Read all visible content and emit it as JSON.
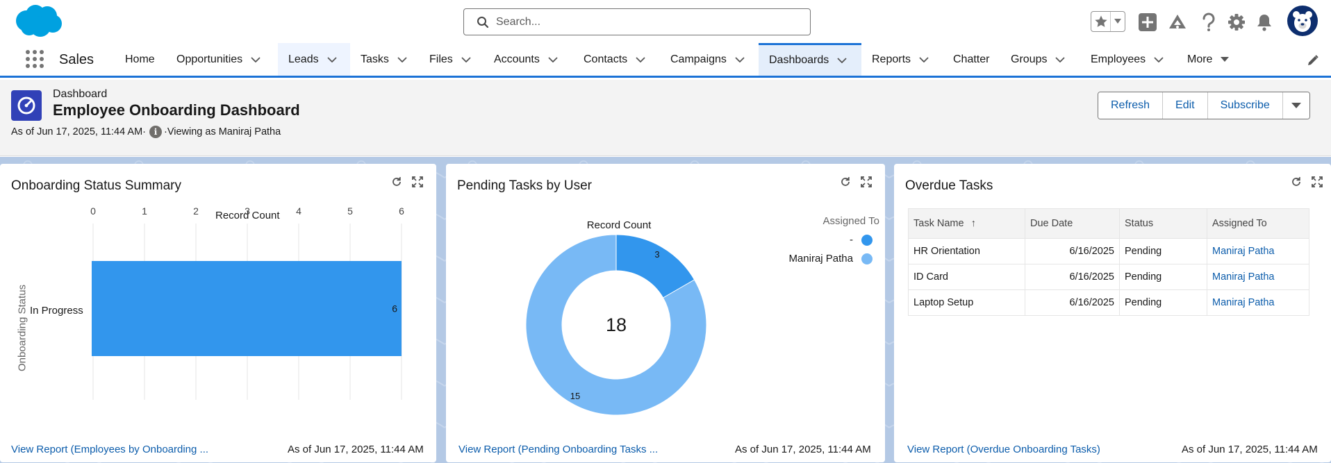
{
  "header": {
    "search_placeholder": "Search...",
    "avatar_icon": "bear-avatar-icon",
    "brand_color": "#00a1e0"
  },
  "nav": {
    "app_name": "Sales",
    "items": [
      {
        "label": "Home",
        "chevron": false
      },
      {
        "label": "Opportunities",
        "chevron": true
      },
      {
        "label": "Leads",
        "chevron": true
      },
      {
        "label": "Tasks",
        "chevron": true
      },
      {
        "label": "Files",
        "chevron": true
      },
      {
        "label": "Accounts",
        "chevron": true
      },
      {
        "label": "Contacts",
        "chevron": true
      },
      {
        "label": "Campaigns",
        "chevron": true
      },
      {
        "label": "Dashboards",
        "chevron": true,
        "active": true
      },
      {
        "label": "Reports",
        "chevron": true
      },
      {
        "label": "Chatter",
        "chevron": false
      },
      {
        "label": "Groups",
        "chevron": true
      },
      {
        "label": "Employees",
        "chevron": true
      },
      {
        "label": "More",
        "chevron": true
      }
    ]
  },
  "page": {
    "object_label": "Dashboard",
    "title": "Employee Onboarding Dashboard",
    "as_of": "As of Jun 17, 2025, 11:44 AM·",
    "viewing_as": "·Viewing as Maniraj Patha",
    "buttons": {
      "refresh": "Refresh",
      "edit": "Edit",
      "subscribe": "Subscribe"
    }
  },
  "widgets": {
    "status_summary": {
      "title": "Onboarding Status Summary",
      "footer_link": "View Report (Employees by Onboarding ...",
      "footer_time": "As of Jun 17, 2025, 11:44 AM"
    },
    "pending_tasks": {
      "title": "Pending Tasks by User",
      "chart_title": "Record Count",
      "legend_title": "Assigned To",
      "total": "18",
      "footer_link": "View Report (Pending Onboarding Tasks ...",
      "footer_time": "As of Jun 17, 2025, 11:44 AM"
    },
    "overdue_tasks": {
      "title": "Overdue Tasks",
      "columns": [
        "Task Name",
        "Due Date",
        "Status",
        "Assigned To"
      ],
      "rows": [
        {
          "task": "HR Orientation",
          "due": "6/16/2025",
          "status": "Pending",
          "assigned": "Maniraj Patha"
        },
        {
          "task": "ID Card",
          "due": "6/16/2025",
          "status": "Pending",
          "assigned": "Maniraj Patha"
        },
        {
          "task": "Laptop Setup",
          "due": "6/16/2025",
          "status": "Pending",
          "assigned": "Maniraj Patha"
        }
      ],
      "footer_link": "View Report (Overdue Onboarding Tasks)",
      "footer_time": "As of Jun 17, 2025, 11:44 AM"
    }
  },
  "chart_data": [
    {
      "type": "bar",
      "orientation": "horizontal",
      "categories": [
        "In Progress"
      ],
      "values": [
        6
      ],
      "data_labels": [
        "6"
      ],
      "xlabel": "Record Count",
      "ylabel": "Onboarding Status",
      "xlim": [
        0,
        6
      ],
      "ticks": [
        "0",
        "1",
        "2",
        "3",
        "4",
        "5",
        "6"
      ],
      "grid": true,
      "color": "#3296ed"
    },
    {
      "type": "pie",
      "donut": true,
      "title": "Record Count",
      "legend_title": "Assigned To",
      "legend_position": "top-right",
      "center_label": "18",
      "slices": [
        {
          "name": "-",
          "value": 3,
          "label": "3",
          "color": "#3296ed"
        },
        {
          "name": "Maniraj Patha",
          "value": 15,
          "label": "15",
          "color": "#78b9f5"
        }
      ]
    }
  ]
}
